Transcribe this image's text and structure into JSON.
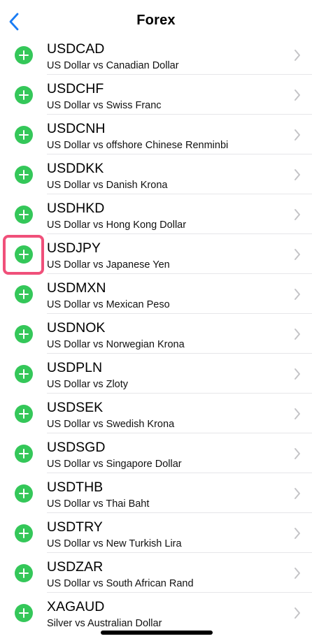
{
  "header": {
    "title": "Forex",
    "back_icon": "chevron-left-icon",
    "accent_color": "#1a7cf4"
  },
  "list": {
    "add_icon": "plus-circle-icon",
    "add_color": "#34c759",
    "items": [
      {
        "symbol": "USDCAD",
        "description": "US Dollar vs Canadian Dollar"
      },
      {
        "symbol": "USDCHF",
        "description": "US Dollar vs Swiss Franc"
      },
      {
        "symbol": "USDCNH",
        "description": "US Dollar vs offshore Chinese Renminbi"
      },
      {
        "symbol": "USDDKK",
        "description": "US Dollar vs Danish Krona"
      },
      {
        "symbol": "USDHKD",
        "description": "US Dollar vs Hong Kong Dollar"
      },
      {
        "symbol": "USDJPY",
        "description": "US Dollar vs Japanese Yen",
        "highlighted": true
      },
      {
        "symbol": "USDMXN",
        "description": "US Dollar vs Mexican Peso"
      },
      {
        "symbol": "USDNOK",
        "description": "US Dollar vs Norwegian Krona"
      },
      {
        "symbol": "USDPLN",
        "description": "US Dollar vs Zloty"
      },
      {
        "symbol": "USDSEK",
        "description": "US Dollar vs Swedish Krona"
      },
      {
        "symbol": "USDSGD",
        "description": "US Dollar vs Singapore Dollar"
      },
      {
        "symbol": "USDTHB",
        "description": "US Dollar vs Thai Baht"
      },
      {
        "symbol": "USDTRY",
        "description": "US Dollar vs New Turkish Lira"
      },
      {
        "symbol": "USDZAR",
        "description": "US Dollar vs South African Rand"
      },
      {
        "symbol": "XAGAUD",
        "description": "Silver vs Australian Dollar"
      }
    ]
  },
  "highlight_color": "#f0507a"
}
